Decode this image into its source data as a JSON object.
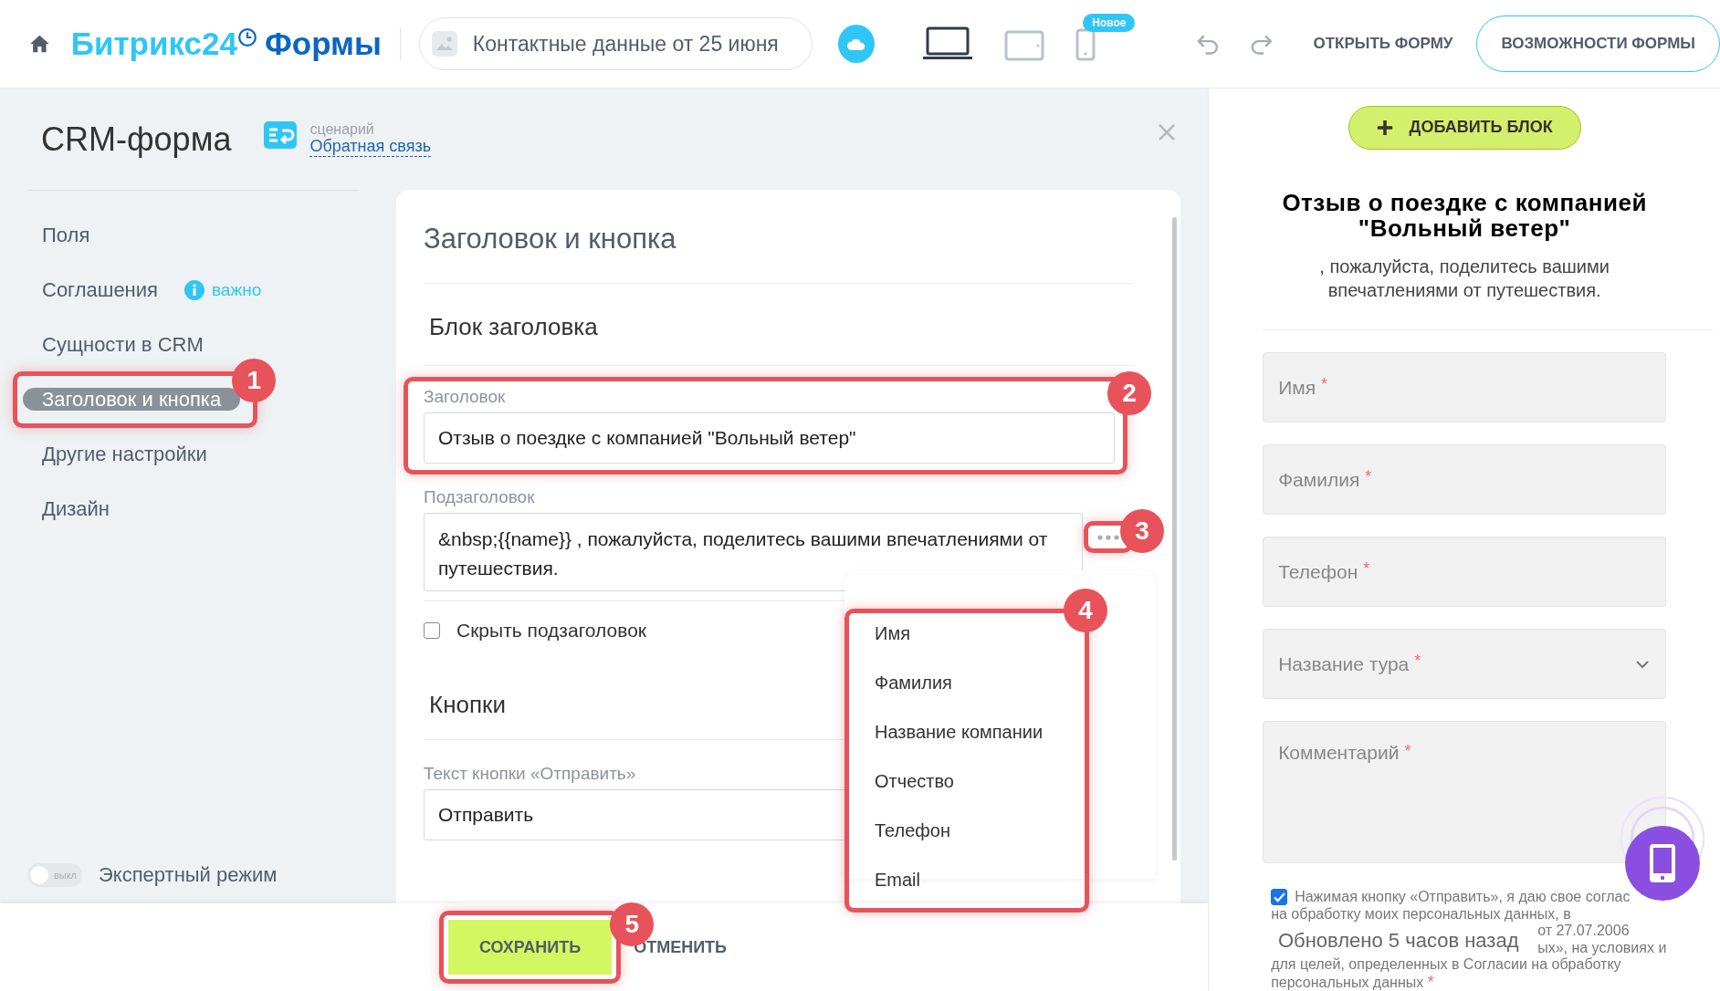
{
  "header": {
    "logo_brand": "Битрикс24",
    "logo_product": "Формы",
    "form_name": "Контактные данные от 25 июня",
    "devices": [
      {
        "kind": "laptop",
        "selected": true
      },
      {
        "kind": "tablet",
        "selected": false
      },
      {
        "kind": "phone",
        "selected": false,
        "badge": "Новое"
      }
    ],
    "open_form": "ОТКРЫТЬ ФОРМУ",
    "features_button": "ВОЗМОЖНОСТИ ФОРМЫ"
  },
  "sidebar": {
    "title": "CRM-форма",
    "scenario_label": "сценарий",
    "scenario_link": "Обратная связь",
    "items": [
      {
        "label": "Поля",
        "selected": false
      },
      {
        "label": "Соглашения",
        "selected": false,
        "badge": "важно"
      },
      {
        "label": "Сущности в CRM",
        "selected": false
      },
      {
        "label": "Заголовок и кнопка",
        "selected": true
      },
      {
        "label": "Другие настройки",
        "selected": false
      },
      {
        "label": "Дизайн",
        "selected": false
      }
    ],
    "expert_mode": {
      "label": "Экспертный режим",
      "toggle_text": "выкл",
      "on": false
    }
  },
  "editor": {
    "title": "Заголовок и кнопка",
    "header_block": {
      "heading": "Блок заголовка",
      "title_label": "Заголовок",
      "title_value": "Отзыв о поездке с компанией \"Вольный ветер\"",
      "subtitle_label": "Подзаголовок",
      "subtitle_value": "&nbsp;{{name}} , пожалуйста, поделитесь вашими впечатлениями от путешествия.",
      "hide_subtitle": {
        "label": "Скрыть подзаголовок",
        "checked": false
      }
    },
    "buttons_block": {
      "heading": "Кнопки",
      "submit_label": "Текст кнопки «Отправить»",
      "submit_value": "Отправить"
    },
    "insert_menu": [
      "Имя",
      "Фамилия",
      "Название компании",
      "Отчество",
      "Телефон",
      "Email"
    ]
  },
  "footer": {
    "save": "СОХРАНИТЬ",
    "cancel": "ОТМЕНИТЬ"
  },
  "preview": {
    "add_block": "ДОБАВИТЬ БЛОК",
    "title": "Отзыв о поездке с компанией \"Вольный ветер\"",
    "subtitle": ", пожалуйста, поделитесь вашими впечатлениями от путешествия.",
    "fields": [
      {
        "kind": "input",
        "label": "Имя",
        "required_mark": "*"
      },
      {
        "kind": "input",
        "label": "Фамилия",
        "required_mark": "*"
      },
      {
        "kind": "input",
        "label": "Телефон",
        "required_mark": "*"
      },
      {
        "kind": "select",
        "label": "Название тура",
        "required_mark": "*"
      },
      {
        "kind": "textarea",
        "label": "Комментарий",
        "required_mark": "*"
      }
    ],
    "consent": {
      "checked": true,
      "required_mark": "*",
      "lines": [
        {
          "kind": "full",
          "text": "Нажимая кнопку «Отправить», я даю свое соглас"
        },
        {
          "kind": "full",
          "text": "на обработку моих персональных данных, в"
        },
        {
          "kind": "partial",
          "text": "от 27.07.2006"
        },
        {
          "kind": "partial",
          "text": "ых», на условиях и"
        },
        {
          "kind": "full",
          "text": "для целей, определенных в Согласии на обработку"
        },
        {
          "kind": "last",
          "text": "персональных данных"
        }
      ]
    },
    "toast": "Обновлено 5 часов назад"
  },
  "callouts": [
    "1",
    "2",
    "3",
    "4",
    "5"
  ]
}
